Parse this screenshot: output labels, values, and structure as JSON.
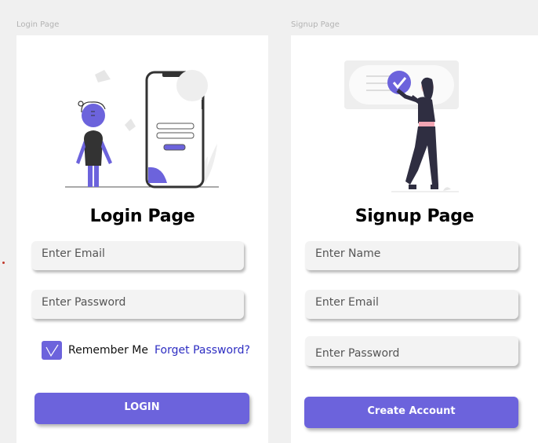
{
  "colors": {
    "accent": "#6c63dc",
    "link": "#2d2dc2",
    "canvas": "#f0f0f0",
    "field": "#f3f3f3"
  },
  "login": {
    "frame_label": "Login Page",
    "title": "Login Page",
    "email_placeholder": "Enter Email",
    "password_placeholder": "Enter Password",
    "remember_label": "Remember Me",
    "remember_checked": true,
    "forgot_label": "Forget Password?",
    "button_label": "LOGIN"
  },
  "signup": {
    "frame_label": "Signup Page",
    "title": "Signup Page",
    "name_placeholder": "Enter Name",
    "email_placeholder": "Enter Email",
    "password_placeholder": "Enter Password",
    "button_label": "Create Account"
  },
  "icons": {
    "login_illustration": "phone-login-illustration",
    "signup_illustration": "woman-checkmark-illustration",
    "checkbox_mark": "checkmark-icon"
  }
}
